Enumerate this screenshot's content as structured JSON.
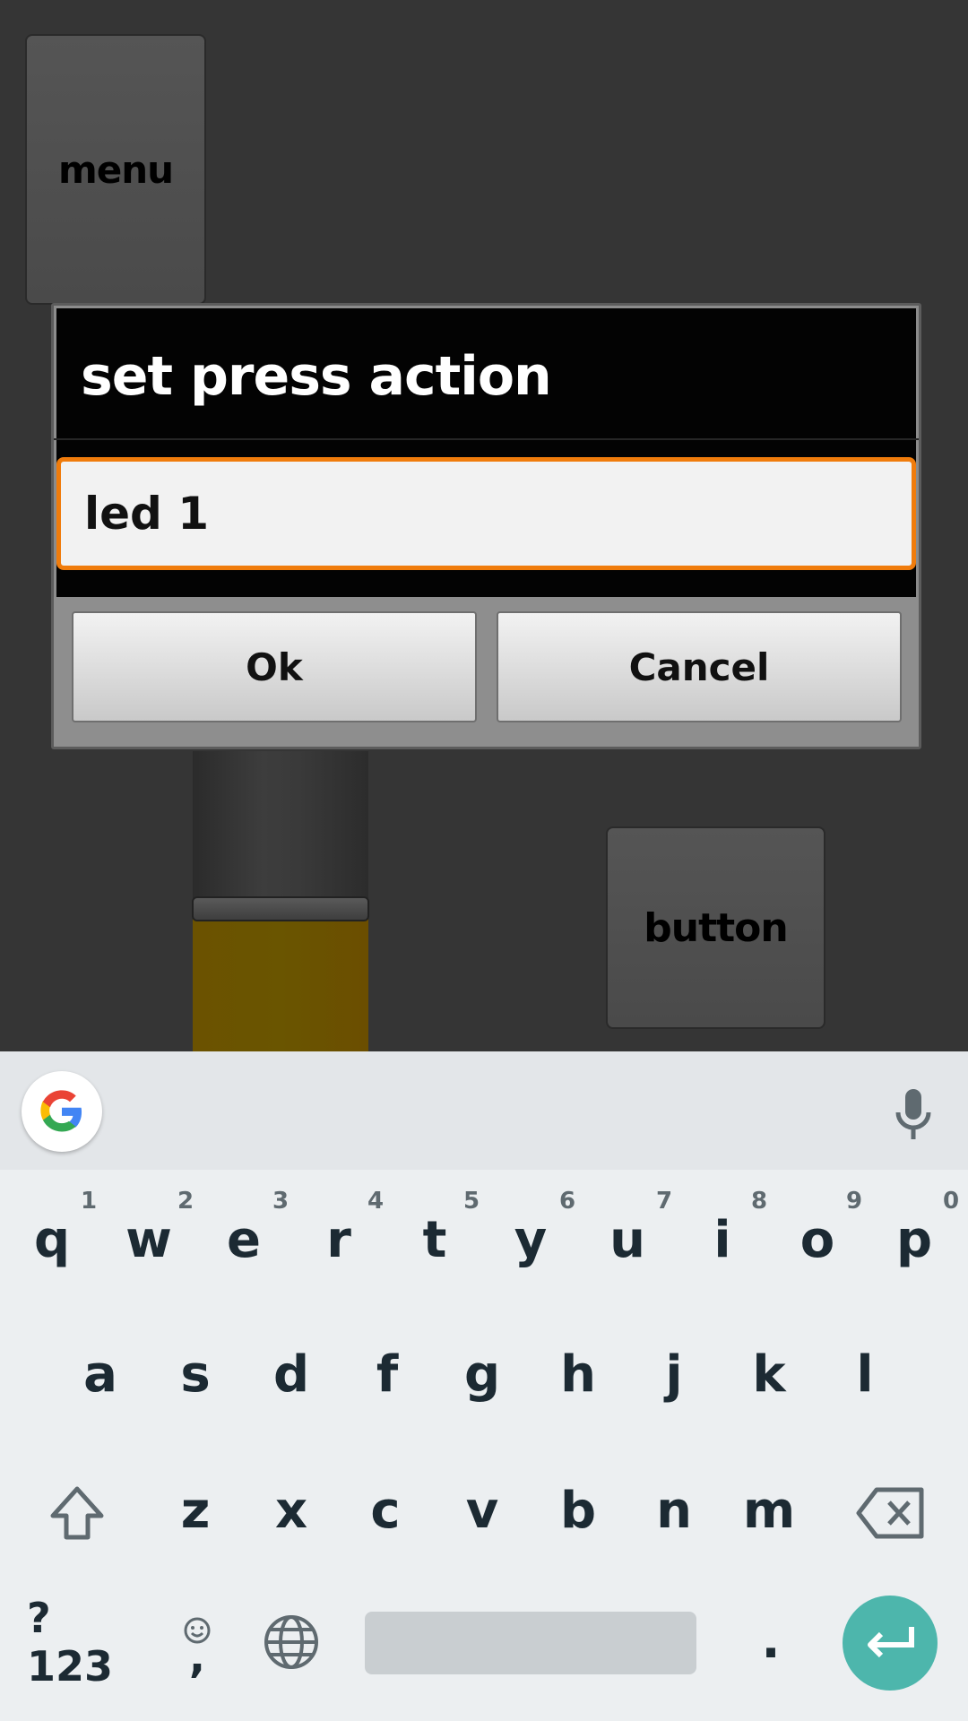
{
  "app": {
    "menu_label": "menu",
    "button_label": "button"
  },
  "dialog": {
    "title": "set press action",
    "input_value": "led 1",
    "ok_label": "Ok",
    "cancel_label": "Cancel",
    "accent_color": "#f07c0c"
  },
  "keyboard": {
    "row1": [
      {
        "key": "q",
        "hint": "1"
      },
      {
        "key": "w",
        "hint": "2"
      },
      {
        "key": "e",
        "hint": "3"
      },
      {
        "key": "r",
        "hint": "4"
      },
      {
        "key": "t",
        "hint": "5"
      },
      {
        "key": "y",
        "hint": "6"
      },
      {
        "key": "u",
        "hint": "7"
      },
      {
        "key": "i",
        "hint": "8"
      },
      {
        "key": "o",
        "hint": "9"
      },
      {
        "key": "p",
        "hint": "0"
      }
    ],
    "row2": [
      "a",
      "s",
      "d",
      "f",
      "g",
      "h",
      "j",
      "k",
      "l"
    ],
    "row3": [
      "z",
      "x",
      "c",
      "v",
      "b",
      "n",
      "m"
    ],
    "symbols_label": "?123",
    "comma": ",",
    "period": ".",
    "icons": [
      "google-logo-icon",
      "microphone-icon",
      "shift-icon",
      "backspace-icon",
      "emoji-icon",
      "globe-icon",
      "enter-icon"
    ],
    "enter_color": "#4db6ac"
  }
}
